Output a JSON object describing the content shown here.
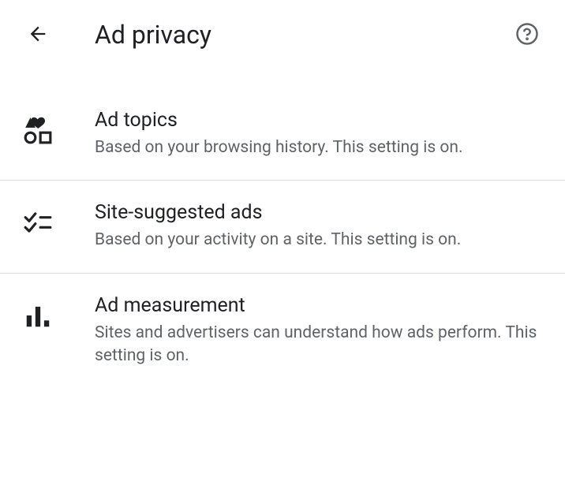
{
  "header": {
    "title": "Ad privacy"
  },
  "settings": [
    {
      "title": "Ad topics",
      "description": "Based on your browsing history. This setting is on."
    },
    {
      "title": "Site-suggested ads",
      "description": "Based on your activity on a site. This setting is on."
    },
    {
      "title": "Ad measurement",
      "description": "Sites and advertisers can understand how ads perform. This setting is on."
    }
  ]
}
